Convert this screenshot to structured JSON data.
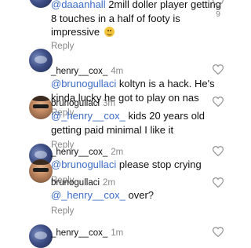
{
  "comments": [
    {
      "username": "",
      "time": "",
      "mention": "@daaanhall",
      "text_line1": " 2mill doller player getting",
      "text_line2": "8 touches in a half of footy is",
      "text_line3": "impressive",
      "emoji": "grimacing-face",
      "reply_label": "Reply",
      "like_count": "9"
    },
    {
      "username": "_henry__cox_",
      "time": "4m",
      "mention": "@brunogullaci",
      "text_line1": " koltyn is a hack. He's",
      "text_line2": "kinda lucky he got to play on nas",
      "reply_label": "Reply"
    },
    {
      "username": "brunogullaci",
      "time": "3m",
      "mention": "@_henry__cox_",
      "text_line1": " kids 20 years old",
      "text_line2": "getting paid minimal I like it",
      "reply_label": "Reply"
    },
    {
      "username": "_henry__cox_",
      "time": "2m",
      "mention": "@brunogullaci",
      "text_line1": " please stop crying",
      "reply_label": "Reply"
    },
    {
      "username": "brunogullaci",
      "time": "2m",
      "mention": "@_henry__cox_",
      "text_line1": " over?",
      "reply_label": "Reply"
    },
    {
      "username": "_henry__cox_",
      "time": "1m"
    }
  ],
  "colors": {
    "mention": "#3d6ec9",
    "secondary_text": "#888888",
    "primary_text": "#111111"
  }
}
